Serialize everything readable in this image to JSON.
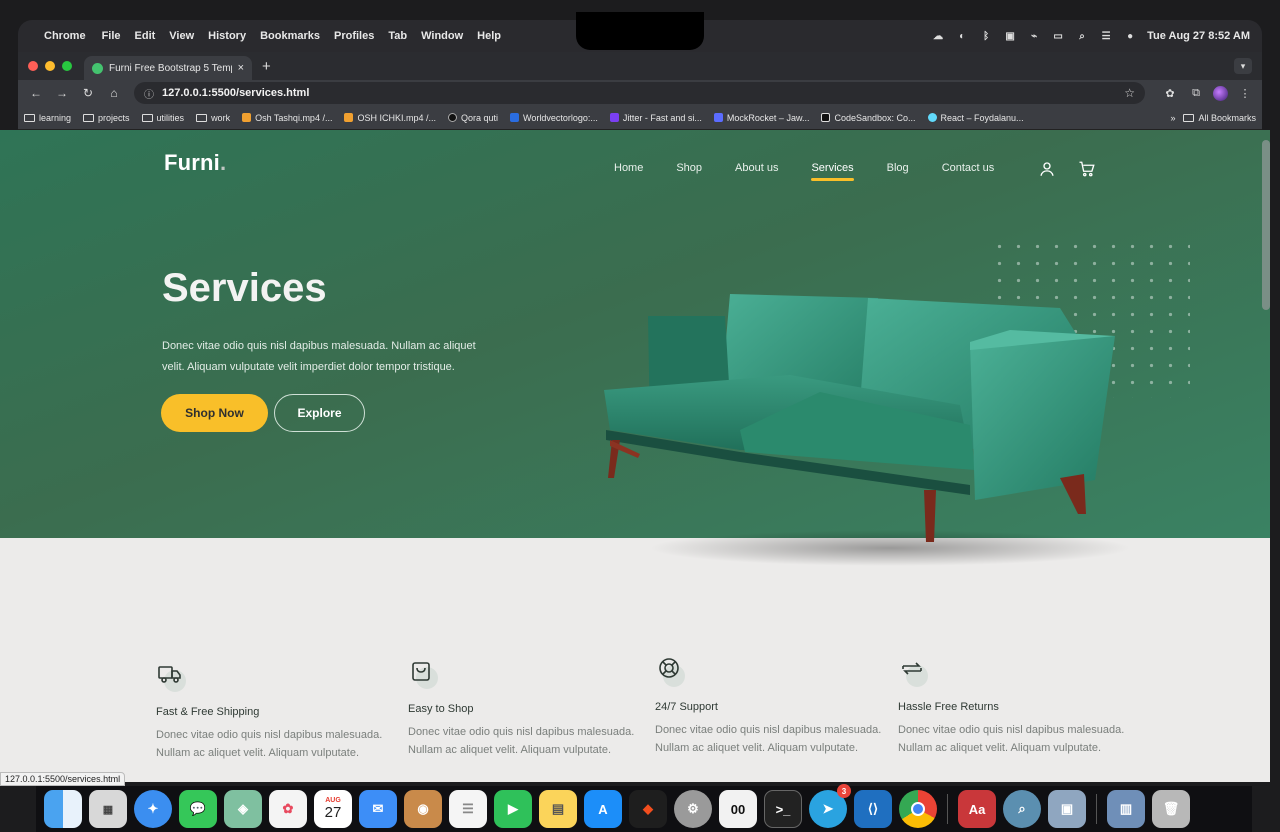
{
  "menubar": {
    "apple": "",
    "items": [
      "Chrome",
      "File",
      "Edit",
      "View",
      "History",
      "Bookmarks",
      "Profiles",
      "Tab",
      "Window",
      "Help"
    ],
    "clock": "Tue Aug 27  8:52 AM"
  },
  "browser": {
    "tab_title": "Furni Free Bootstrap 5 Templ",
    "tab_close": "×",
    "new_tab": "+",
    "url": "127.0.0.1:5500/services.html",
    "bookmarks": [
      "learning",
      "projects",
      "utilities",
      "work",
      "Osh Tashqi.mp4 /...",
      "OSH ICHKI.mp4 /...",
      "Qora quti",
      "Worldvectorlogo:...",
      "Jitter - Fast and si...",
      "MockRocket – Jaw...",
      "CodeSandbox: Co...",
      "React – Foydalanu..."
    ],
    "bookmarks_overflow": "»",
    "all_bookmarks": "All Bookmarks",
    "status_url": "127.0.0.1:5500/services.html"
  },
  "site": {
    "logo": "Furni",
    "logo_dot": ".",
    "nav": [
      "Home",
      "Shop",
      "About us",
      "Services",
      "Blog",
      "Contact us"
    ],
    "active_nav": "Services",
    "hero": {
      "title": "Services",
      "text": "Donec vitae odio quis nisl dapibus malesuada. Nullam ac aliquet velit. Aliquam vulputate velit imperdiet dolor tempor tristique.",
      "primary_button": "Shop Now",
      "secondary_button": "Explore"
    },
    "features": [
      {
        "icon": "truck-icon",
        "title": "Fast & Free Shipping",
        "text": "Donec vitae odio quis nisl dapibus malesuada. Nullam ac aliquet velit. Aliquam vulputate."
      },
      {
        "icon": "bag-icon",
        "title": "Easy to Shop",
        "text": "Donec vitae odio quis nisl dapibus malesuada. Nullam ac aliquet velit. Aliquam vulputate."
      },
      {
        "icon": "support-icon",
        "title": "24/7 Support",
        "text": "Donec vitae odio quis nisl dapibus malesuada. Nullam ac aliquet velit. Aliquam vulputate."
      },
      {
        "icon": "return-icon",
        "title": "Hassle Free Returns",
        "text": "Donec vitae odio quis nisl dapibus malesuada. Nullam ac aliquet velit. Aliquam vulputate."
      }
    ],
    "colors": {
      "hero_bg": "#3b6d4f",
      "accent": "#f9bf29",
      "page_bg": "#ecebea"
    }
  },
  "dock": {
    "calendar_month": "AUG",
    "calendar_day": "27",
    "telegram_badge": "3",
    "dictionary_label": "Aa"
  }
}
